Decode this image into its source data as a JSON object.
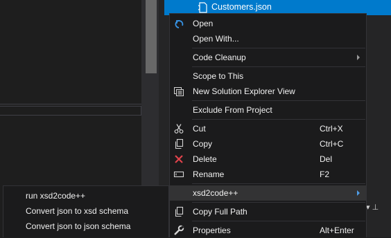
{
  "explorer": {
    "selected_file": "Customers.json"
  },
  "toolbar": {
    "tools_glyph": "▾ ⊥"
  },
  "context_menu": {
    "items": [
      {
        "label": "Open",
        "icon": "open-arrow-icon"
      },
      {
        "label": "Open With..."
      },
      {
        "label": "Code Cleanup",
        "submenu": true
      },
      {
        "label": "Scope to This"
      },
      {
        "label": "New Solution Explorer View",
        "icon": "solution-explorer-icon"
      },
      {
        "label": "Exclude From Project"
      },
      {
        "label": "Cut",
        "shortcut": "Ctrl+X",
        "icon": "scissors-icon"
      },
      {
        "label": "Copy",
        "shortcut": "Ctrl+C",
        "icon": "copy-icon"
      },
      {
        "label": "Delete",
        "shortcut": "Del",
        "icon": "delete-x-icon"
      },
      {
        "label": "Rename",
        "shortcut": "F2",
        "icon": "rename-icon"
      },
      {
        "label": "xsd2code++",
        "submenu": true,
        "highlighted": true
      },
      {
        "label": "Copy Full Path",
        "icon": "copy-icon"
      },
      {
        "label": "Properties",
        "shortcut": "Alt+Enter",
        "icon": "wrench-icon"
      }
    ]
  },
  "submenu": {
    "items": [
      {
        "label": "run xsd2code++"
      },
      {
        "label": "Convert json to xsd schema"
      },
      {
        "label": "Convert json to json schema"
      }
    ]
  },
  "colors": {
    "selection": "#007acc",
    "menu_bg": "#1b1b1c",
    "delete_icon": "#e0434b",
    "open_icon": "#3794e6"
  }
}
